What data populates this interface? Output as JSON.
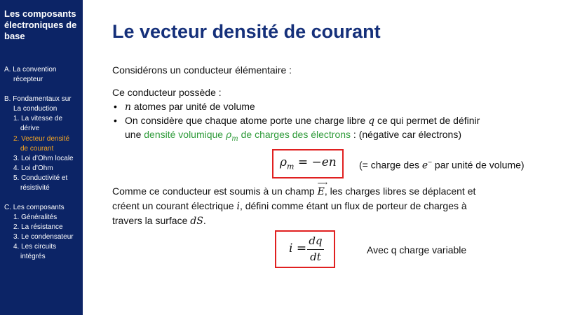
{
  "sidebar": {
    "title_lines": [
      "Les composants",
      "électroniques de",
      "base"
    ],
    "outline": [
      "A.  La convention",
      "récepteur",
      "B.  Fondamentaux sur",
      "La conduction",
      "1. La vitesse de",
      "dérive",
      "2. Vecteur densité",
      "de courant",
      "3. Loi d’Ohm locale",
      "4. Loi d’Ohm",
      "5. Conductivité et",
      "résistivité",
      "C.  Les composants",
      "1. Généralités",
      "2. La résistance",
      "3. Le condensateur",
      "4. Les circuits",
      "intégrés"
    ],
    "active_color": "#f5a623",
    "background": "#0c2466"
  },
  "slide": {
    "title": "Le vecteur densité de courant",
    "title_color": "#15307a",
    "intro": "Considérons un conducteur élémentaire :",
    "possede": "Ce conducteur possède :",
    "bullet1": {
      "var": "n",
      "text": " atomes par unité de volume"
    },
    "bullet2": {
      "line1_a": "On considère que chaque atome porte une charge libre ",
      "line1_var": "q",
      "line1_b": " ce qui permet de définir",
      "line2_a": "une ",
      "line2_green_a": "densité volumique ",
      "line2_green_var": "ρ",
      "line2_green_sub": "m",
      "line2_green_b": " de charges des électrons",
      "line2_b": " : (négative car électrons)"
    },
    "eq1": {
      "lhs": "ρ",
      "lhs_sub": "m",
      "rhs": " = −en"
    },
    "eq1_note_a": "(= charge des ",
    "eq1_note_var": "e",
    "eq1_note_sup": "−",
    "eq1_note_b": " par unité de volume)",
    "para": {
      "line1_a": "Comme ce conducteur est soumis à un champ ",
      "line1_var": "E",
      "line1_b": ", les charges libres se déplacent et",
      "line2_a": "créent un courant électrique ",
      "line2_var": "i",
      "line2_b": ", défini comme étant un flux de porteur de charges à",
      "line3_a": "travers la surface ",
      "line3_var": "dS",
      "line3_b": "."
    },
    "eq2": {
      "lhs": "i =",
      "num": "dq",
      "den": "dt"
    },
    "eq2_note": "Avec q charge variable",
    "box_color": "#e02020",
    "highlight_color": "#2f9b3a"
  }
}
